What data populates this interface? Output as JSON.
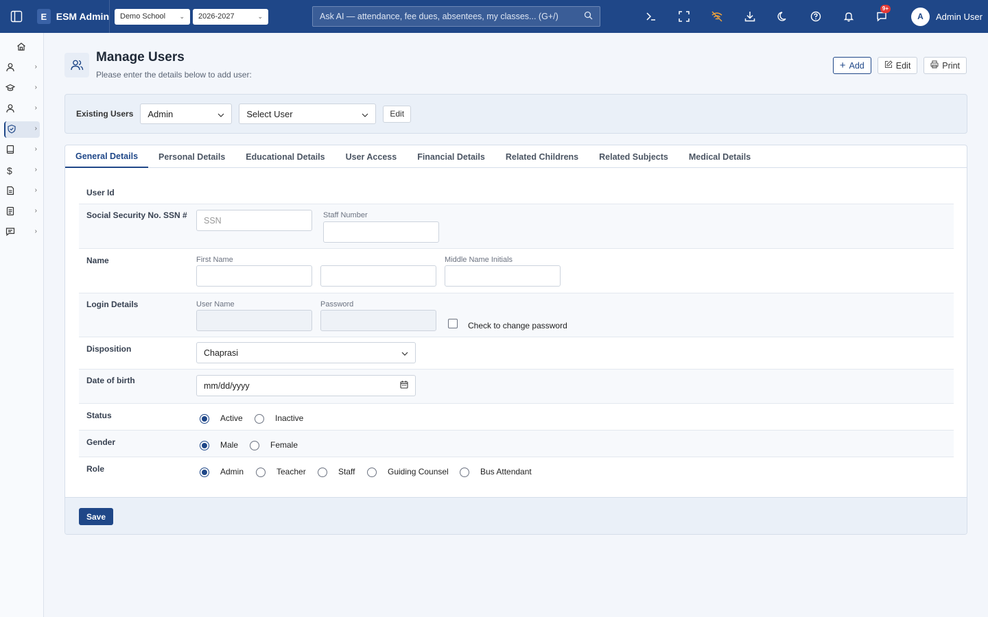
{
  "topbar": {
    "brand_initial": "E",
    "brand_name": "ESM Admin",
    "school": "Demo School",
    "year": "2026-2027",
    "search_placeholder": "Ask AI — attendance, fee dues, absentees, my classes... (G+/)",
    "notification_badge": "9+",
    "user_initial": "A",
    "user_name": "Admin User"
  },
  "header": {
    "title": "Manage Users",
    "subtitle": "Please enter the details below to add user:",
    "add_label": "Add",
    "edit_label": "Edit",
    "print_label": "Print"
  },
  "existing": {
    "label": "Existing Users",
    "role_value": "Admin",
    "user_value": "Select User",
    "edit_label": "Edit"
  },
  "tabs": [
    "General Details",
    "Personal Details",
    "Educational Details",
    "User Access",
    "Financial Details",
    "Related Childrens",
    "Related Subjects",
    "Medical Details"
  ],
  "form": {
    "user_id_label": "User Id",
    "ssn_label": "Social Security No. SSN #",
    "ssn_placeholder": "SSN",
    "staff_number_label": "Staff Number",
    "name_label": "Name",
    "first_name_label": "First Name",
    "middle_name_label": "Middle Name Initials",
    "login_label": "Login Details",
    "username_label": "User Name",
    "password_label": "Password",
    "change_password_label": "Check to change password",
    "disposition_label": "Disposition",
    "disposition_value": "Chaprasi",
    "dob_label": "Date of birth",
    "dob_placeholder": "mm/dd/yyyy",
    "status_label": "Status",
    "status_options": [
      "Active",
      "Inactive"
    ],
    "gender_label": "Gender",
    "gender_options": [
      "Male",
      "Female"
    ],
    "role_label": "Role",
    "role_options": [
      "Admin",
      "Teacher",
      "Staff",
      "Guiding Counsel",
      "Bus Attendant"
    ]
  },
  "save_label": "Save"
}
